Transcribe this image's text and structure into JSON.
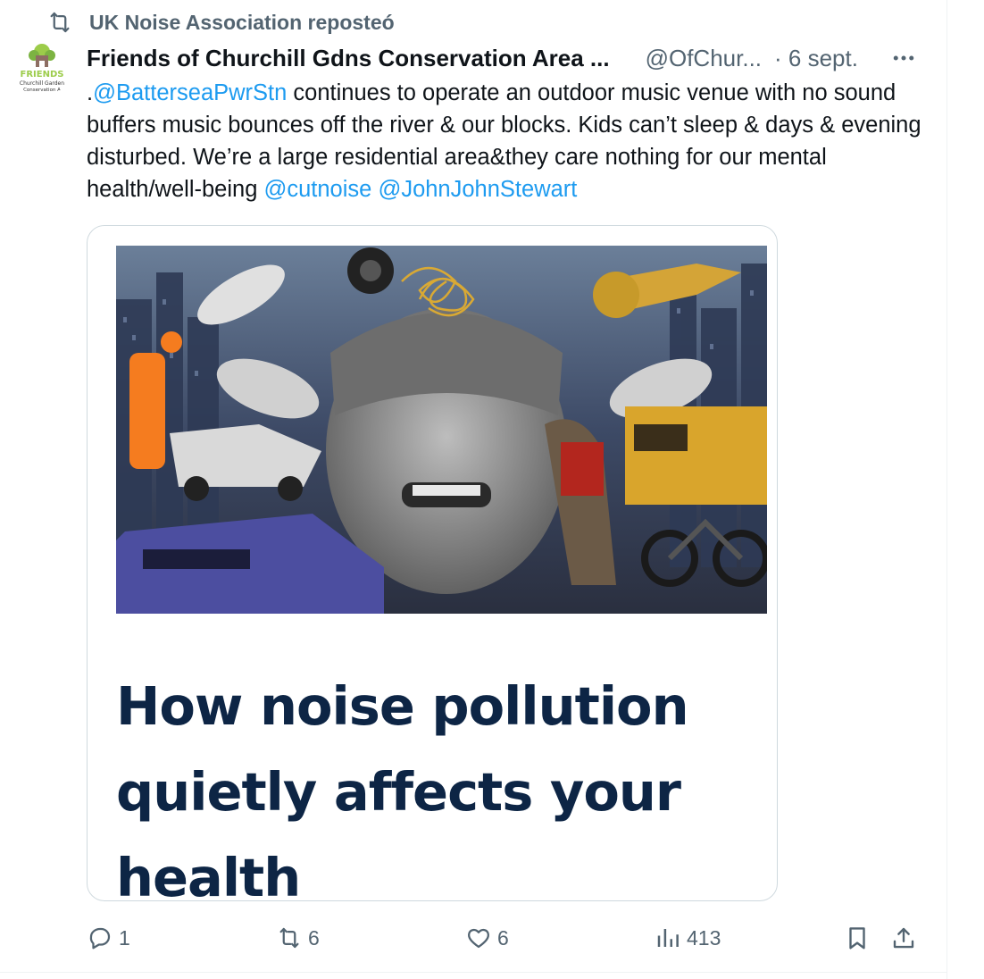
{
  "repost": {
    "text": "UK Noise Association reposteó"
  },
  "tweet": {
    "author_name": "Friends of Churchill Gdns Conservation Area ...",
    "author_handle": "@OfChur...",
    "timestamp": "· 6 sept.",
    "avatar_text": {
      "line1": "FRIENDS",
      "line2": "Churchill Garden",
      "line3": "Conservation A"
    },
    "text": {
      "prefix": ".",
      "mention1": "@BatterseaPwrStn",
      "body": " continues to operate an outdoor music venue with no sound buffers music bounces off the river & our blocks. Kids can’t sleep & days & evening disturbed. We’re a large residential area&they care nothing for our mental health/well-being ",
      "mention2": "@cutnoise",
      "space": " ",
      "mention3": "@JohnJohnStewart"
    },
    "card": {
      "headline": "How noise pollution quietly affects your health"
    }
  },
  "actions": {
    "replies": "1",
    "reposts": "6",
    "likes": "6",
    "views": "413"
  },
  "colors": {
    "link": "#1d9bf0",
    "secondary_text": "#536471",
    "headline": "#0d2545",
    "border": "#cfd9de"
  },
  "icons": [
    "repost-icon",
    "more-icon",
    "reply-icon",
    "repost-icon",
    "like-icon",
    "views-icon",
    "bookmark-icon",
    "share-icon"
  ]
}
